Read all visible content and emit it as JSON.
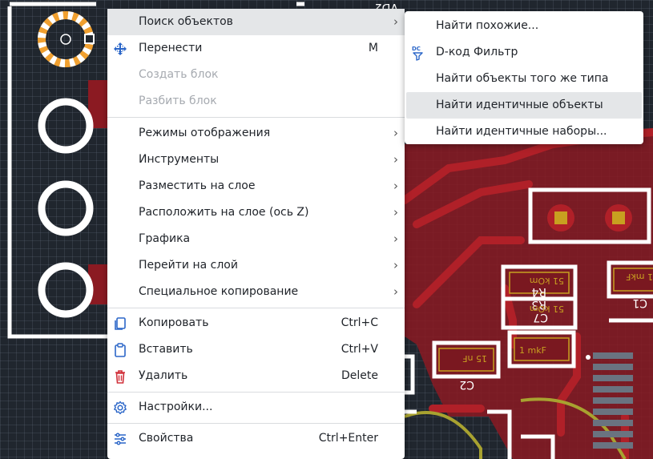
{
  "context_menu": {
    "items": [
      {
        "label": "Поиск объектов",
        "shortcut": "",
        "submenu": true,
        "enabled": true,
        "highlighted": true,
        "icon": ""
      },
      {
        "label": "Перенести",
        "shortcut": "M",
        "submenu": false,
        "enabled": true,
        "icon": "move-icon"
      },
      {
        "label": "Создать блок",
        "shortcut": "",
        "submenu": false,
        "enabled": false,
        "icon": ""
      },
      {
        "label": "Разбить блок",
        "shortcut": "",
        "submenu": false,
        "enabled": false,
        "icon": ""
      },
      {
        "label": "Режимы отображения",
        "shortcut": "",
        "submenu": true,
        "enabled": true,
        "icon": ""
      },
      {
        "label": "Инструменты",
        "shortcut": "",
        "submenu": true,
        "enabled": true,
        "icon": ""
      },
      {
        "label": "Разместить на слое",
        "shortcut": "",
        "submenu": true,
        "enabled": true,
        "icon": ""
      },
      {
        "label": "Расположить на слое (ось Z)",
        "shortcut": "",
        "submenu": true,
        "enabled": true,
        "icon": ""
      },
      {
        "label": "Графика",
        "shortcut": "",
        "submenu": true,
        "enabled": true,
        "icon": ""
      },
      {
        "label": "Перейти на слой",
        "shortcut": "",
        "submenu": true,
        "enabled": true,
        "icon": ""
      },
      {
        "label": "Специальное копирование",
        "shortcut": "",
        "submenu": true,
        "enabled": true,
        "icon": ""
      },
      {
        "label": "Копировать",
        "shortcut": "Ctrl+C",
        "submenu": false,
        "enabled": true,
        "icon": "copy-icon"
      },
      {
        "label": "Вставить",
        "shortcut": "Ctrl+V",
        "submenu": false,
        "enabled": true,
        "icon": "paste-icon"
      },
      {
        "label": "Удалить",
        "shortcut": "Delete",
        "submenu": false,
        "enabled": true,
        "icon": "trash-icon"
      },
      {
        "label": "Настройки...",
        "shortcut": "",
        "submenu": false,
        "enabled": true,
        "icon": "gear-icon"
      },
      {
        "label": "Свойства",
        "shortcut": "Ctrl+Enter",
        "submenu": false,
        "enabled": true,
        "icon": "sliders-icon"
      }
    ]
  },
  "submenu": {
    "items": [
      {
        "label": "Найти похожие...",
        "icon": ""
      },
      {
        "label": "D-код Фильтр",
        "icon": "dc-filter-icon",
        "icon_text": "DC"
      },
      {
        "label": "Найти объекты того же типа",
        "icon": ""
      },
      {
        "label": "Найти идентичные объекты",
        "icon": "",
        "highlighted": true
      },
      {
        "label": "Найти идентичные наборы...",
        "icon": ""
      }
    ]
  },
  "pcb": {
    "silk_labels": [
      "VD2",
      "R4",
      "R3",
      "C7",
      "C1",
      "C2"
    ],
    "value_labels": [
      "51 kOm",
      "51 kOm",
      "1 mkF",
      "15 nF",
      "1 mkF"
    ]
  },
  "colors": {
    "canvas": "#20262e",
    "copper": "#8b1a22",
    "silkscreen": "#ffffff",
    "selected_pad": "#f0a030",
    "accent_icon": "#2b66c8",
    "delete_icon": "#d0303a"
  }
}
